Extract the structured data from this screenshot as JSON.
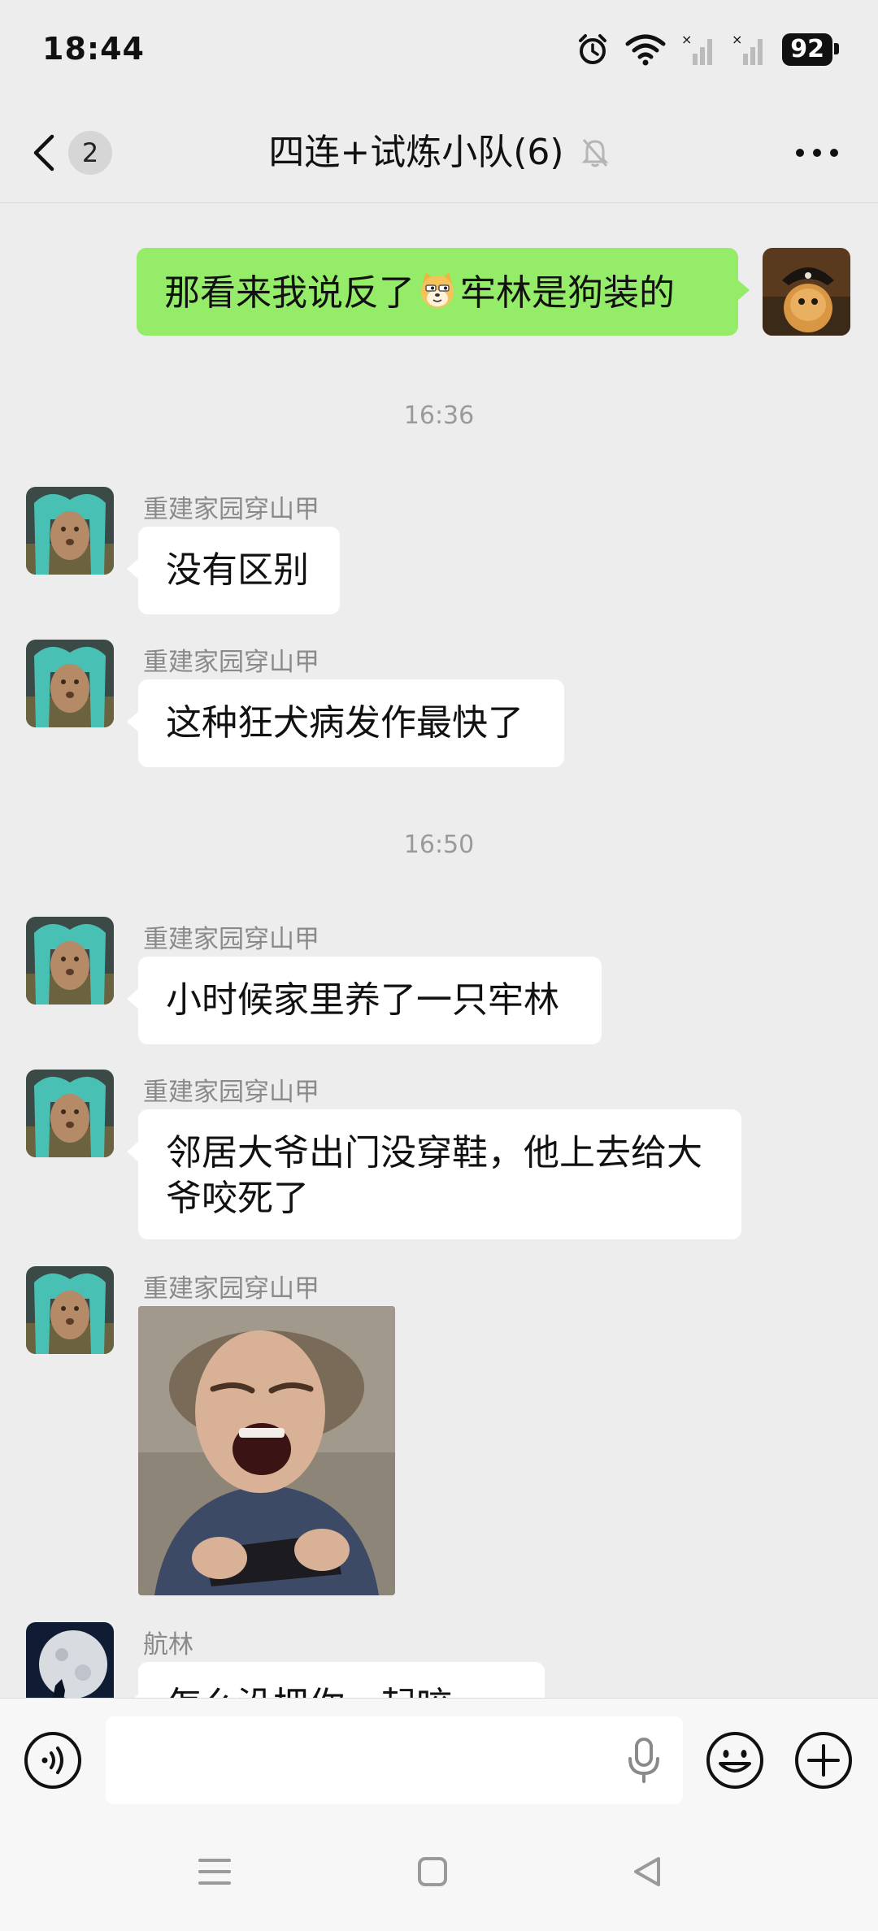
{
  "status_bar": {
    "time": "18:44",
    "battery": "92",
    "icons": [
      "alarm-icon",
      "wifi-icon",
      "signal-icon",
      "signal-icon"
    ]
  },
  "header": {
    "back_count": "2",
    "title": "四连+试炼小队(6)",
    "muted_icon": "bell-off-icon",
    "more_icon": "more-icon"
  },
  "messages": {
    "m1": {
      "text_before": "那看来我说反了",
      "emoji": "dog-emoji",
      "text_after": "牢林是狗装的",
      "side": "right"
    },
    "t1": "16:36",
    "m2": {
      "sender": "重建家园穿山甲",
      "text": "没有区别"
    },
    "m3": {
      "sender": "重建家园穿山甲",
      "text": "这种狂犬病发作最快了"
    },
    "t2": "16:50",
    "m4": {
      "sender": "重建家园穿山甲",
      "text": "小时候家里养了一只牢林"
    },
    "m5": {
      "sender": "重建家园穿山甲",
      "line1": "邻居大爷出门没穿鞋，他上去给大",
      "line2": "爷咬死了"
    },
    "m6": {
      "sender": "重建家园穿山甲",
      "type": "sticker"
    },
    "m7": {
      "sender": "航林",
      "text": "怎么没把你一起咬死？"
    }
  },
  "input_bar": {
    "voice_icon": "voice-icon",
    "mic_icon": "mic-icon",
    "emoji_icon": "emoji-icon",
    "plus_icon": "plus-icon"
  },
  "colors": {
    "background": "#ededed",
    "my_bubble": "#95ec69",
    "other_bubble": "#ffffff"
  }
}
